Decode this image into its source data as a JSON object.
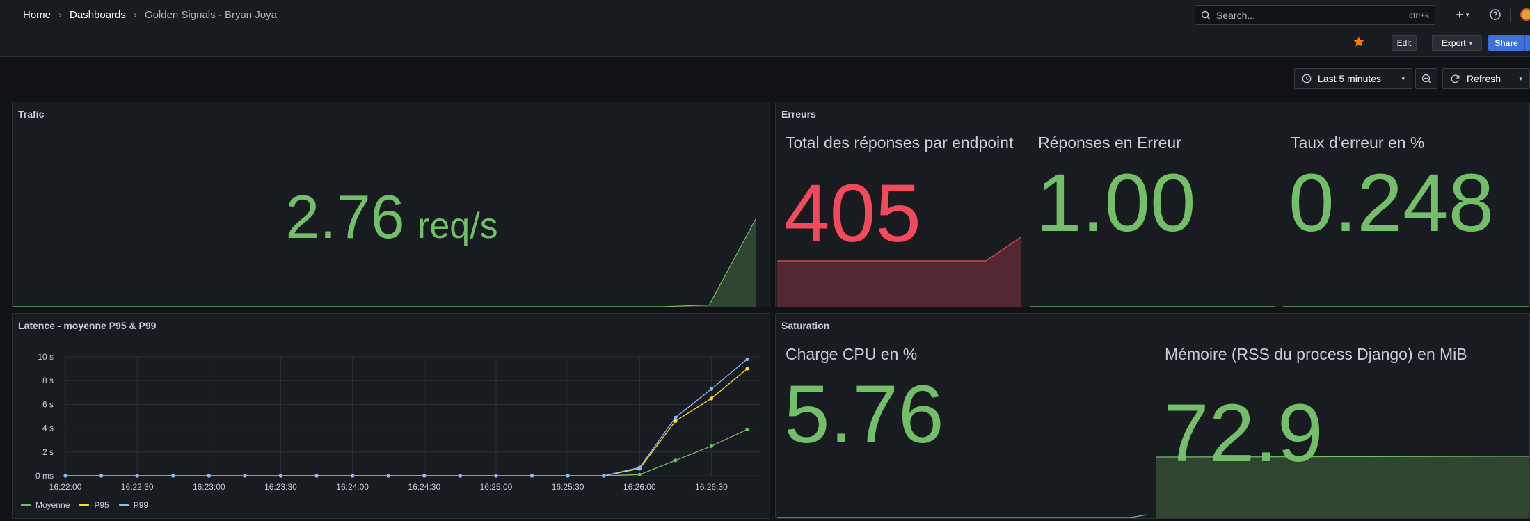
{
  "breadcrumb": {
    "home": "Home",
    "dashboards": "Dashboards",
    "current": "Golden Signals - Bryan Joya",
    "separator": "›"
  },
  "search": {
    "placeholder": "Search...",
    "shortcut": "ctrl+k"
  },
  "top_actions": {
    "add": "+",
    "add_caret": "▾",
    "help_icon": "help-icon"
  },
  "toolbar": {
    "edit_label": "Edit",
    "export_label": "Export",
    "share_label": "Share",
    "star_color": "#ff7f00"
  },
  "time_controls": {
    "range_label": "Last 5 minutes",
    "refresh_label": "Refresh"
  },
  "colors": {
    "green": "#73bf69",
    "red": "#f2495c",
    "yellow": "#fade2a",
    "blue": "#8ab8ff",
    "accent": "#3d71d9"
  },
  "panels": {
    "trafic": {
      "title": "Trafic",
      "value": "2.76",
      "unit": "req/s",
      "sparkline": [
        0,
        0,
        0,
        0,
        0,
        0,
        0,
        0,
        0,
        0,
        0,
        0,
        0,
        0,
        0,
        0.02,
        1.0
      ]
    },
    "erreurs": {
      "title": "Erreurs",
      "stats": [
        {
          "title": "Total des réponses par endpoint",
          "value": "405",
          "color": "red"
        },
        {
          "title": "Réponses en Erreur",
          "value": "1.00",
          "color": "green"
        },
        {
          "title": "Taux d'erreur en %",
          "value": "0.248",
          "color": "green"
        }
      ]
    },
    "latence": {
      "title": "Latence - moyenne P95 & P99"
    },
    "saturation": {
      "title": "Saturation",
      "stats": [
        {
          "title": "Charge CPU en %",
          "value": "5.76"
        },
        {
          "title": "Mémoire (RSS du process Django) en MiB",
          "value": "72.9"
        }
      ]
    }
  },
  "chart_data": {
    "type": "line",
    "title": "Latence - moyenne P95 & P99",
    "x": [
      "16:22:00",
      "16:22:15",
      "16:22:30",
      "16:22:45",
      "16:23:00",
      "16:23:15",
      "16:23:30",
      "16:23:45",
      "16:24:00",
      "16:24:15",
      "16:24:30",
      "16:24:45",
      "16:25:00",
      "16:25:15",
      "16:25:30",
      "16:25:45",
      "16:26:00",
      "16:26:15",
      "16:26:30",
      "16:26:45"
    ],
    "x_tick_labels": [
      "16:22:00",
      "16:22:30",
      "16:23:00",
      "16:23:30",
      "16:24:00",
      "16:24:30",
      "16:25:00",
      "16:25:30",
      "16:26:00",
      "16:26:30"
    ],
    "y_tick_labels": [
      "0 ms",
      "2 s",
      "4 s",
      "6 s",
      "8 s",
      "10 s"
    ],
    "ylim": [
      0,
      10
    ],
    "y_unit": "s",
    "grid": true,
    "legend_position": "bottom-left",
    "series": [
      {
        "name": "Moyenne",
        "color": "#73bf69",
        "values": [
          0,
          0,
          0,
          0,
          0,
          0,
          0,
          0,
          0,
          0,
          0,
          0,
          0,
          0,
          0,
          0,
          0.1,
          1.3,
          2.5,
          3.9
        ]
      },
      {
        "name": "P95",
        "color": "#fade2a",
        "values": [
          0,
          0,
          0,
          0,
          0,
          0,
          0,
          0,
          0,
          0,
          0,
          0,
          0,
          0,
          0,
          0,
          0.6,
          4.6,
          6.5,
          9.0
        ]
      },
      {
        "name": "P99",
        "color": "#8ab8ff",
        "values": [
          0,
          0,
          0,
          0,
          0,
          0,
          0,
          0,
          0,
          0,
          0,
          0,
          0,
          0,
          0,
          0,
          0.7,
          4.9,
          7.3,
          9.8
        ]
      }
    ]
  }
}
